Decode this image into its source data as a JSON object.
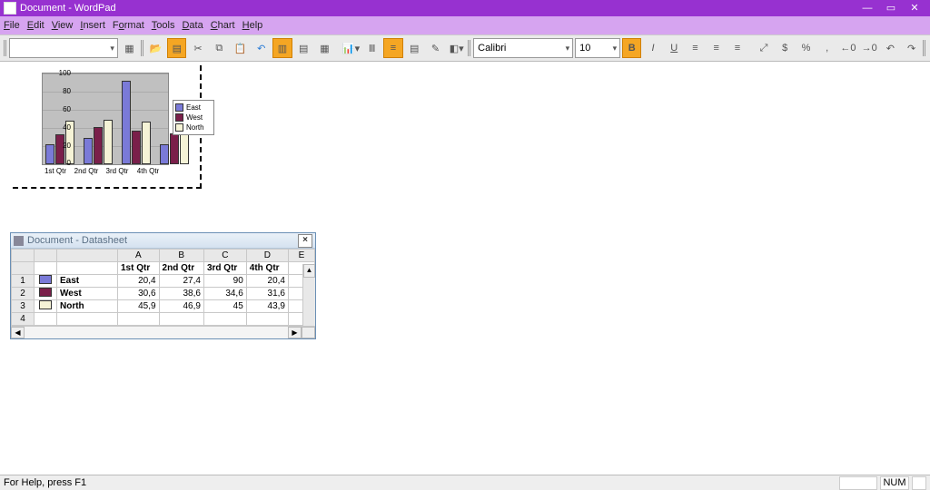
{
  "window": {
    "title": "Document - WordPad",
    "min": "—",
    "max": "▭",
    "close": "✕"
  },
  "menu": {
    "file": "File",
    "edit": "Edit",
    "view": "View",
    "insert": "Insert",
    "format": "Format",
    "tools": "Tools",
    "data": "Data",
    "chart": "Chart",
    "help": "Help"
  },
  "toolbar": {
    "font_name": "Calibri",
    "font_size": "10",
    "bold": "B",
    "italic": "I",
    "underline": "U",
    "currency": "%",
    "comma": ",",
    "dec_inc": ".0",
    "dec_dec": ".00"
  },
  "chart_data": {
    "type": "bar",
    "categories": [
      "1st Qtr",
      "2nd Qtr",
      "3rd Qtr",
      "4th Qtr"
    ],
    "series": [
      {
        "name": "East",
        "values": [
          20.4,
          27.4,
          90,
          20.4
        ]
      },
      {
        "name": "West",
        "values": [
          30.6,
          38.6,
          34.6,
          31.6
        ]
      },
      {
        "name": "North",
        "values": [
          45.9,
          46.9,
          45,
          43.9
        ]
      }
    ],
    "ylim": [
      0,
      100
    ],
    "yticks": [
      0,
      20,
      40,
      60,
      80,
      100
    ],
    "legend": [
      "East",
      "West",
      "North"
    ]
  },
  "datasheet": {
    "title": "Document - Datasheet",
    "cols": [
      "A",
      "B",
      "C",
      "D",
      "E"
    ],
    "col_heads": [
      "1st Qtr",
      "2nd Qtr",
      "3rd Qtr",
      "4th Qtr"
    ],
    "rows": [
      {
        "n": "1",
        "name": "East",
        "v": [
          "20,4",
          "27,4",
          "90",
          "20,4"
        ]
      },
      {
        "n": "2",
        "name": "West",
        "v": [
          "30,6",
          "38,6",
          "34,6",
          "31,6"
        ]
      },
      {
        "n": "3",
        "name": "North",
        "v": [
          "45,9",
          "46,9",
          "45",
          "43,9"
        ]
      },
      {
        "n": "4",
        "name": "",
        "v": [
          "",
          "",
          "",
          ""
        ]
      }
    ]
  },
  "status": {
    "help": "For Help, press F1",
    "num": "NUM"
  },
  "colors": {
    "east": "#7a7ad8",
    "west": "#7a1f4a",
    "north": "#f5f3d6"
  }
}
